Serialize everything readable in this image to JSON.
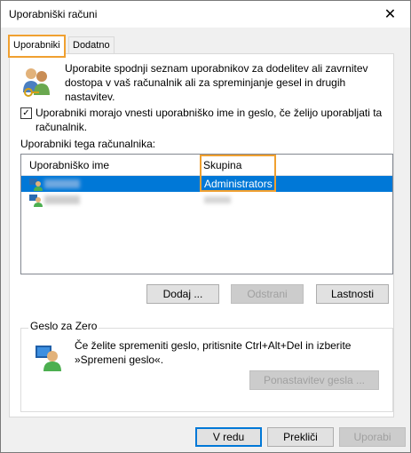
{
  "window": {
    "title": "Uporabniški računi",
    "close_symbol": "✕"
  },
  "tabs": [
    {
      "label": "Uporabniki",
      "active": true
    },
    {
      "label": "Dodatno",
      "active": false
    }
  ],
  "users_tab": {
    "intro_text": "Uporabite spodnji seznam uporabnikov za dodelitev ali zavrnitev dostopa v vaš računalnik ali za spreminjanje gesel in drugih nastavitev.",
    "require_login_checkbox": {
      "checked": true,
      "label": "Uporabniki morajo vnesti uporabniško ime in geslo, če želijo uporabljati ta računalnik."
    },
    "list_caption": "Uporabniki tega računalnika:",
    "columns": [
      "Uporabniško ime",
      "Skupina"
    ],
    "rows": [
      {
        "group": "Administrators",
        "selected": true
      },
      {
        "group": "",
        "selected": false
      }
    ],
    "buttons": {
      "add": "Dodaj ...",
      "remove": "Odstrani",
      "properties": "Lastnosti"
    },
    "password_group": {
      "title": "Geslo za Zero",
      "text": "Če želite spremeniti geslo, pritisnite Ctrl+Alt+Del in izberite »Spremeni geslo«.",
      "reset_button": "Ponastavitev gesla ..."
    }
  },
  "dialog_buttons": {
    "ok": "V redu",
    "cancel": "Prekliči",
    "apply": "Uporabi"
  },
  "colors": {
    "highlight": "#f0a030",
    "selection": "#0078d7"
  }
}
